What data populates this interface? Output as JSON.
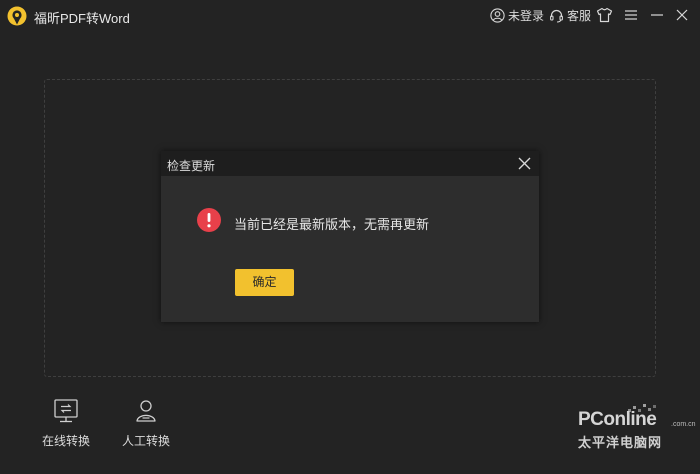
{
  "app": {
    "title": "福昕PDF转Word"
  },
  "titlebar": {
    "login_label": "未登录",
    "service_label": "客服",
    "icons": [
      "user-icon",
      "headset-icon",
      "tshirt-icon",
      "menu-icon",
      "minimize-icon",
      "close-icon"
    ]
  },
  "dialog": {
    "title": "检查更新",
    "message": "当前已经是最新版本，无需再更新",
    "ok_label": "确定",
    "alert_color": "#e8404a",
    "button_color": "#f2c12e"
  },
  "bottom_nav": {
    "items": [
      {
        "label": "在线转换",
        "icon": "online-convert-icon"
      },
      {
        "label": "人工转换",
        "icon": "manual-convert-icon"
      }
    ]
  },
  "watermark": {
    "brand": "PConline",
    "domain": ".com.cn",
    "subtitle": "太平洋电脑网"
  }
}
